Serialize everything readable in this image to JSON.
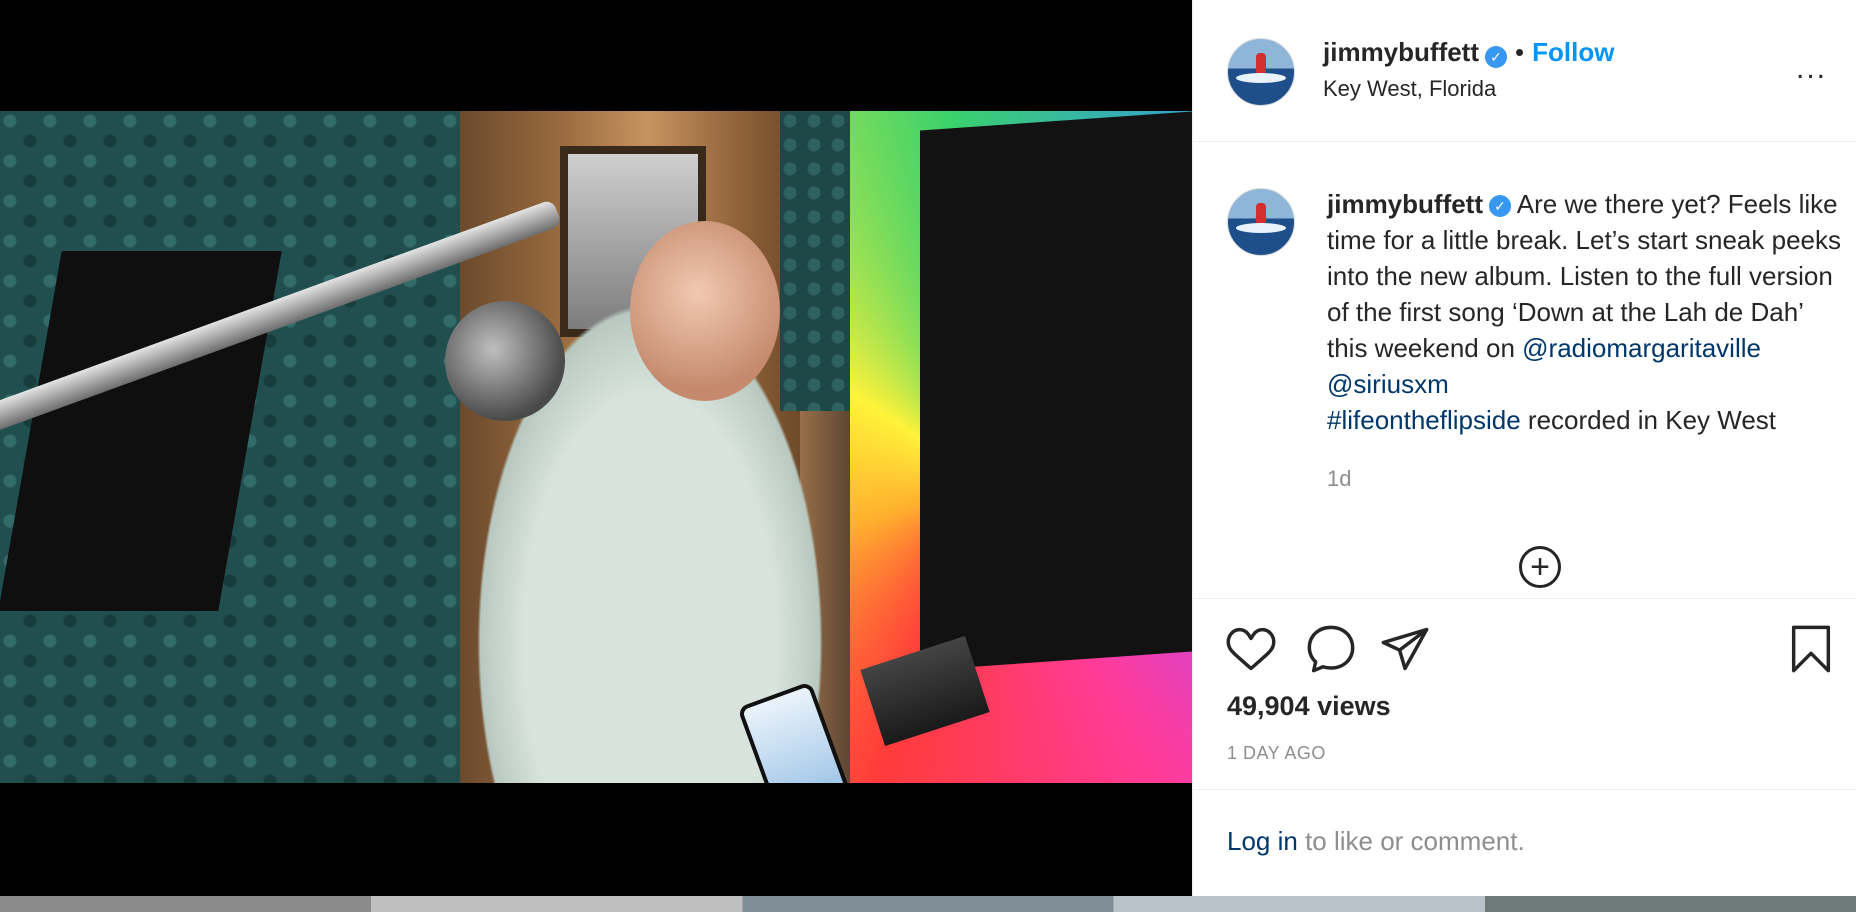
{
  "post": {
    "username": "jimmybuffett",
    "verified_icon": "verified-badge-icon",
    "follow_label": "Follow",
    "separator": "•",
    "location": "Key West, Florida",
    "more_label": "..."
  },
  "caption": {
    "username": "jimmybuffett",
    "text_1": " Are we there yet? Feels like time for a little break. Let’s start sneak peeks into the new album. Listen to the full version of the first song ‘Down at the Lah de Dah’ this weekend on ",
    "mention_1": "@radiomargaritaville",
    "space": " ",
    "mention_2": "@siriusxm",
    "hashtag": "#lifeontheflipside",
    "text_2": " recorded in Key West",
    "age": "1d"
  },
  "load_more": {
    "label": "+"
  },
  "actions": {
    "like_icon": "heart-icon",
    "comment_icon": "comment-icon",
    "share_icon": "share-icon",
    "save_icon": "bookmark-icon",
    "views": "49,904 views",
    "time_ago": "1 DAY AGO"
  },
  "login": {
    "link": "Log in",
    "rest": " to like or comment."
  },
  "colors": {
    "link": "#00376b",
    "follow": "#0095f6",
    "muted": "#8e8e8e",
    "verified": "#3897f0"
  }
}
